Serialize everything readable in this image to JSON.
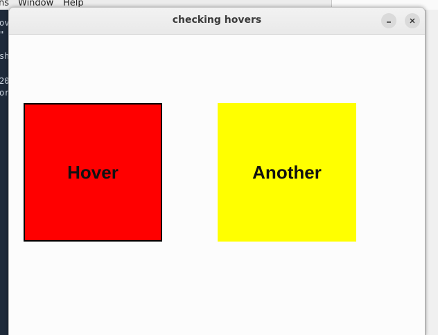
{
  "background": {
    "menubar": [
      "ns",
      "Window",
      "Help"
    ],
    "code_fragments": [
      "ov",
      "\"",
      "sho",
      "20",
      "or"
    ]
  },
  "window": {
    "title": "checking hovers",
    "minimize_glyph": "–",
    "close_glyph": "×"
  },
  "boxes": [
    {
      "label": "Hover",
      "color": "#ff0000",
      "border": "#000000"
    },
    {
      "label": "Another",
      "color": "#ffff00",
      "border": "none"
    }
  ],
  "colors": {
    "titlebar": "#ebebeb",
    "content": "#fcfcfc",
    "editor": "#1e2a3a"
  }
}
